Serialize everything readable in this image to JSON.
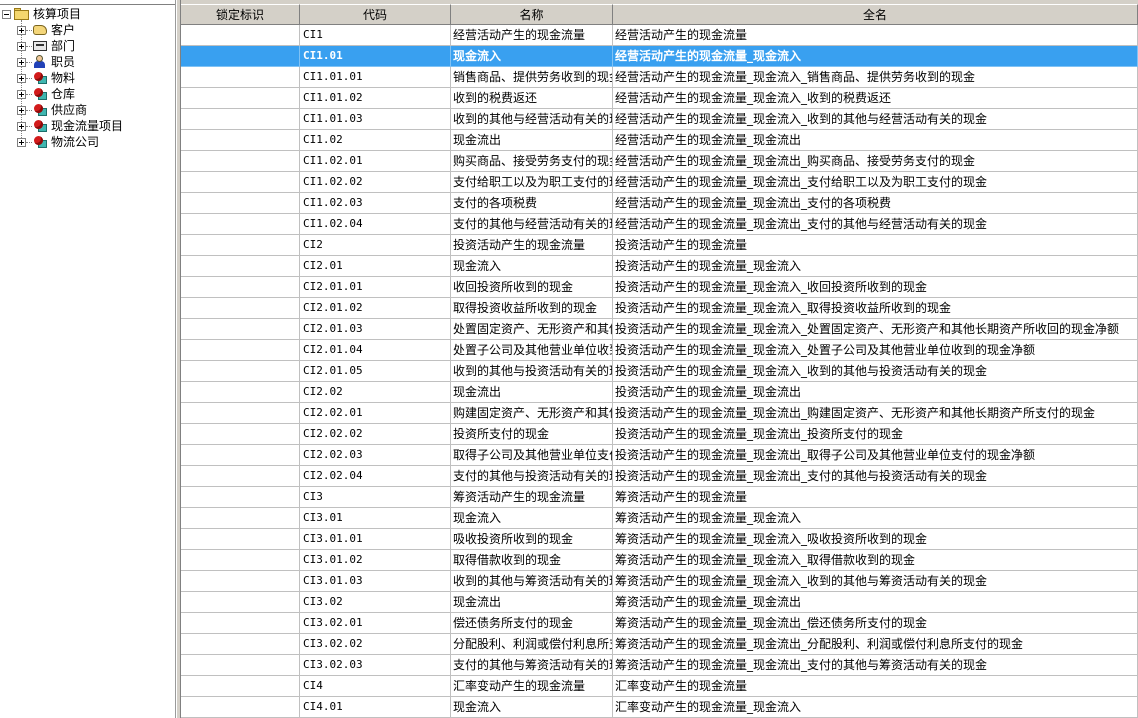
{
  "tree": {
    "root": {
      "label": "核算项目",
      "expanded": true
    },
    "items": [
      {
        "label": "客户",
        "icon": "customer-icon"
      },
      {
        "label": "部门",
        "icon": "department-icon"
      },
      {
        "label": "职员",
        "icon": "employee-icon"
      },
      {
        "label": "物料",
        "icon": "item-icon"
      },
      {
        "label": "仓库",
        "icon": "item-icon"
      },
      {
        "label": "供应商",
        "icon": "item-icon"
      },
      {
        "label": "现金流量项目",
        "icon": "item-icon"
      },
      {
        "label": "物流公司",
        "icon": "item-icon"
      }
    ]
  },
  "grid": {
    "columns": [
      "锁定标识",
      "代码",
      "名称",
      "全名"
    ],
    "selected_row_index": 1,
    "selection_color": "#39a0f0",
    "rows": [
      [
        "",
        "CI1",
        "经营活动产生的现金流量",
        "经营活动产生的现金流量"
      ],
      [
        "",
        "CI1.01",
        "现金流入",
        "经营活动产生的现金流量_现金流入"
      ],
      [
        "",
        "CI1.01.01",
        "销售商品、提供劳务收到的现金",
        "经营活动产生的现金流量_现金流入_销售商品、提供劳务收到的现金"
      ],
      [
        "",
        "CI1.01.02",
        "收到的税费返还",
        "经营活动产生的现金流量_现金流入_收到的税费返还"
      ],
      [
        "",
        "CI1.01.03",
        "收到的其他与经营活动有关的现金",
        "经营活动产生的现金流量_现金流入_收到的其他与经营活动有关的现金"
      ],
      [
        "",
        "CI1.02",
        "现金流出",
        "经营活动产生的现金流量_现金流出"
      ],
      [
        "",
        "CI1.02.01",
        "购买商品、接受劳务支付的现金",
        "经营活动产生的现金流量_现金流出_购买商品、接受劳务支付的现金"
      ],
      [
        "",
        "CI1.02.02",
        "支付给职工以及为职工支付的现金",
        "经营活动产生的现金流量_现金流出_支付给职工以及为职工支付的现金"
      ],
      [
        "",
        "CI1.02.03",
        "支付的各项税费",
        "经营活动产生的现金流量_现金流出_支付的各项税费"
      ],
      [
        "",
        "CI1.02.04",
        "支付的其他与经营活动有关的现金",
        "经营活动产生的现金流量_现金流出_支付的其他与经营活动有关的现金"
      ],
      [
        "",
        "CI2",
        "投资活动产生的现金流量",
        "投资活动产生的现金流量"
      ],
      [
        "",
        "CI2.01",
        "现金流入",
        "投资活动产生的现金流量_现金流入"
      ],
      [
        "",
        "CI2.01.01",
        "收回投资所收到的现金",
        "投资活动产生的现金流量_现金流入_收回投资所收到的现金"
      ],
      [
        "",
        "CI2.01.02",
        "取得投资收益所收到的现金",
        "投资活动产生的现金流量_现金流入_取得投资收益所收到的现金"
      ],
      [
        "",
        "CI2.01.03",
        "处置固定资产、无形资产和其他长期资产所收回的现金净额",
        "投资活动产生的现金流量_现金流入_处置固定资产、无形资产和其他长期资产所收回的现金净额"
      ],
      [
        "",
        "CI2.01.04",
        "处置子公司及其他营业单位收到的现金净额",
        "投资活动产生的现金流量_现金流入_处置子公司及其他营业单位收到的现金净额"
      ],
      [
        "",
        "CI2.01.05",
        "收到的其他与投资活动有关的现金",
        "投资活动产生的现金流量_现金流入_收到的其他与投资活动有关的现金"
      ],
      [
        "",
        "CI2.02",
        "现金流出",
        "投资活动产生的现金流量_现金流出"
      ],
      [
        "",
        "CI2.02.01",
        "购建固定资产、无形资产和其他长期资产所支付的现金",
        "投资活动产生的现金流量_现金流出_购建固定资产、无形资产和其他长期资产所支付的现金"
      ],
      [
        "",
        "CI2.02.02",
        "投资所支付的现金",
        "投资活动产生的现金流量_现金流出_投资所支付的现金"
      ],
      [
        "",
        "CI2.02.03",
        "取得子公司及其他营业单位支付的现金净额",
        "投资活动产生的现金流量_现金流出_取得子公司及其他营业单位支付的现金净额"
      ],
      [
        "",
        "CI2.02.04",
        "支付的其他与投资活动有关的现金",
        "投资活动产生的现金流量_现金流出_支付的其他与投资活动有关的现金"
      ],
      [
        "",
        "CI3",
        "筹资活动产生的现金流量",
        "筹资活动产生的现金流量"
      ],
      [
        "",
        "CI3.01",
        "现金流入",
        "筹资活动产生的现金流量_现金流入"
      ],
      [
        "",
        "CI3.01.01",
        "吸收投资所收到的现金",
        "筹资活动产生的现金流量_现金流入_吸收投资所收到的现金"
      ],
      [
        "",
        "CI3.01.02",
        "取得借款收到的现金",
        "筹资活动产生的现金流量_现金流入_取得借款收到的现金"
      ],
      [
        "",
        "CI3.01.03",
        "收到的其他与筹资活动有关的现金",
        "筹资活动产生的现金流量_现金流入_收到的其他与筹资活动有关的现金"
      ],
      [
        "",
        "CI3.02",
        "现金流出",
        "筹资活动产生的现金流量_现金流出"
      ],
      [
        "",
        "CI3.02.01",
        "偿还债务所支付的现金",
        "筹资活动产生的现金流量_现金流出_偿还债务所支付的现金"
      ],
      [
        "",
        "CI3.02.02",
        "分配股利、利润或偿付利息所支付的现金",
        "筹资活动产生的现金流量_现金流出_分配股利、利润或偿付利息所支付的现金"
      ],
      [
        "",
        "CI3.02.03",
        "支付的其他与筹资活动有关的现金",
        "筹资活动产生的现金流量_现金流出_支付的其他与筹资活动有关的现金"
      ],
      [
        "",
        "CI4",
        "汇率变动产生的现金流量",
        "汇率变动产生的现金流量"
      ],
      [
        "",
        "CI4.01",
        "现金流入",
        "汇率变动产生的现金流量_现金流入"
      ]
    ]
  }
}
